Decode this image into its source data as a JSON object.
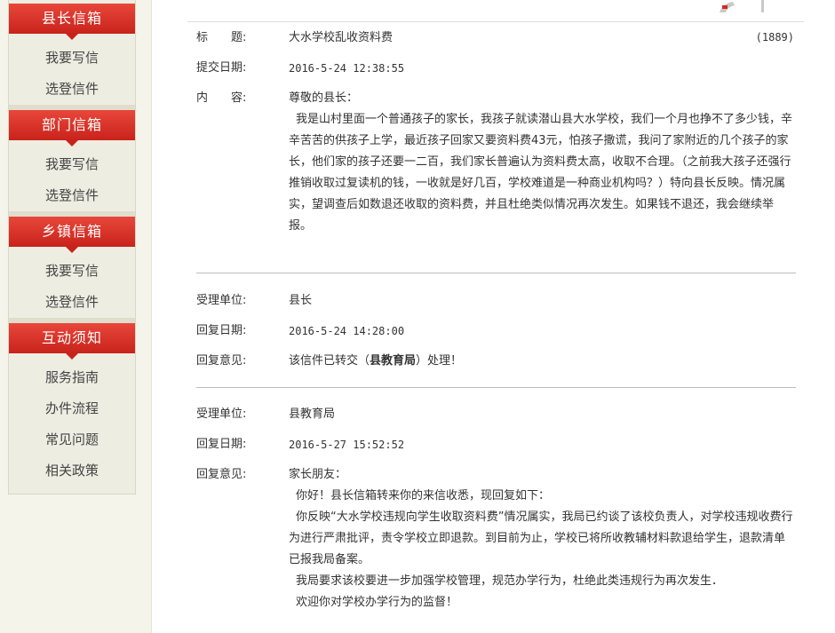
{
  "sidebar": {
    "sections": [
      {
        "title": "县长信箱",
        "links": [
          "我要写信",
          "选登信件"
        ]
      },
      {
        "title": "部门信箱",
        "links": [
          "我要写信",
          "选登信件"
        ]
      },
      {
        "title": "乡镇信箱",
        "links": [
          "我要写信",
          "选登信件"
        ]
      },
      {
        "title": "互动须知",
        "links": [
          "服务指南",
          "办件流程",
          "常见问题",
          "相关政策"
        ]
      }
    ]
  },
  "letter": {
    "subject_label": "标　　题:",
    "subject": "大水学校乱收资料费",
    "view_count": "(1889)",
    "date_label": "提交日期:",
    "date": "2016-5-24 12:38:55",
    "content_label": "内　　容:",
    "greeting": "尊敬的县长：",
    "body": "我是山村里面一个普通孩子的家长，我孩子就读潜山县大水学校，我们一个月也挣不了多少钱，辛辛苦苦的供孩子上学，最近孩子回家又要资料费43元，怕孩子撒谎，我问了家附近的几个孩子的家长，他们家的孩子还要一二百，我们家长普遍认为资料费太高，收取不合理。（之前我大孩子还强行推销收取过复读机的钱，一收就是好几百，学校难道是一种商业机构吗？）特向县长反映。情况属实，望调查后如数退还收取的资料费，并且杜绝类似情况再次发生。如果钱不退还，我会继续举报。"
  },
  "replies": [
    {
      "unit_label": "受理单位:",
      "unit": "县长",
      "date_label": "回复日期:",
      "date": "2016-5-24 14:28:00",
      "opinion_label": "回复意见:",
      "opinion_pre": "该信件已转交（",
      "opinion_bold": "县教育局",
      "opinion_post": "）处理！"
    },
    {
      "unit_label": "受理单位:",
      "unit": "县教育局",
      "date_label": "回复日期:",
      "date": "2016-5-27 15:52:52",
      "opinion_label": "回复意见:",
      "greeting": "家长朋友：",
      "p1": "你好！县长信箱转来你的来信收悉，现回复如下：",
      "p2": "你反映“大水学校违规向学生收取资料费”情况属实，我局已约谈了该校负责人，对学校违规收费行为进行严肃批评，责令学校立即退款。到目前为止，学校已将所收教辅材料款退给学生，退款清单已报我局备案。",
      "p3": "我局要求该校要进一步加强学校管理，规范办学行为，杜绝此类违规行为再次发生．",
      "p4": "欢迎你对学校办学行为的监督！"
    }
  ]
}
